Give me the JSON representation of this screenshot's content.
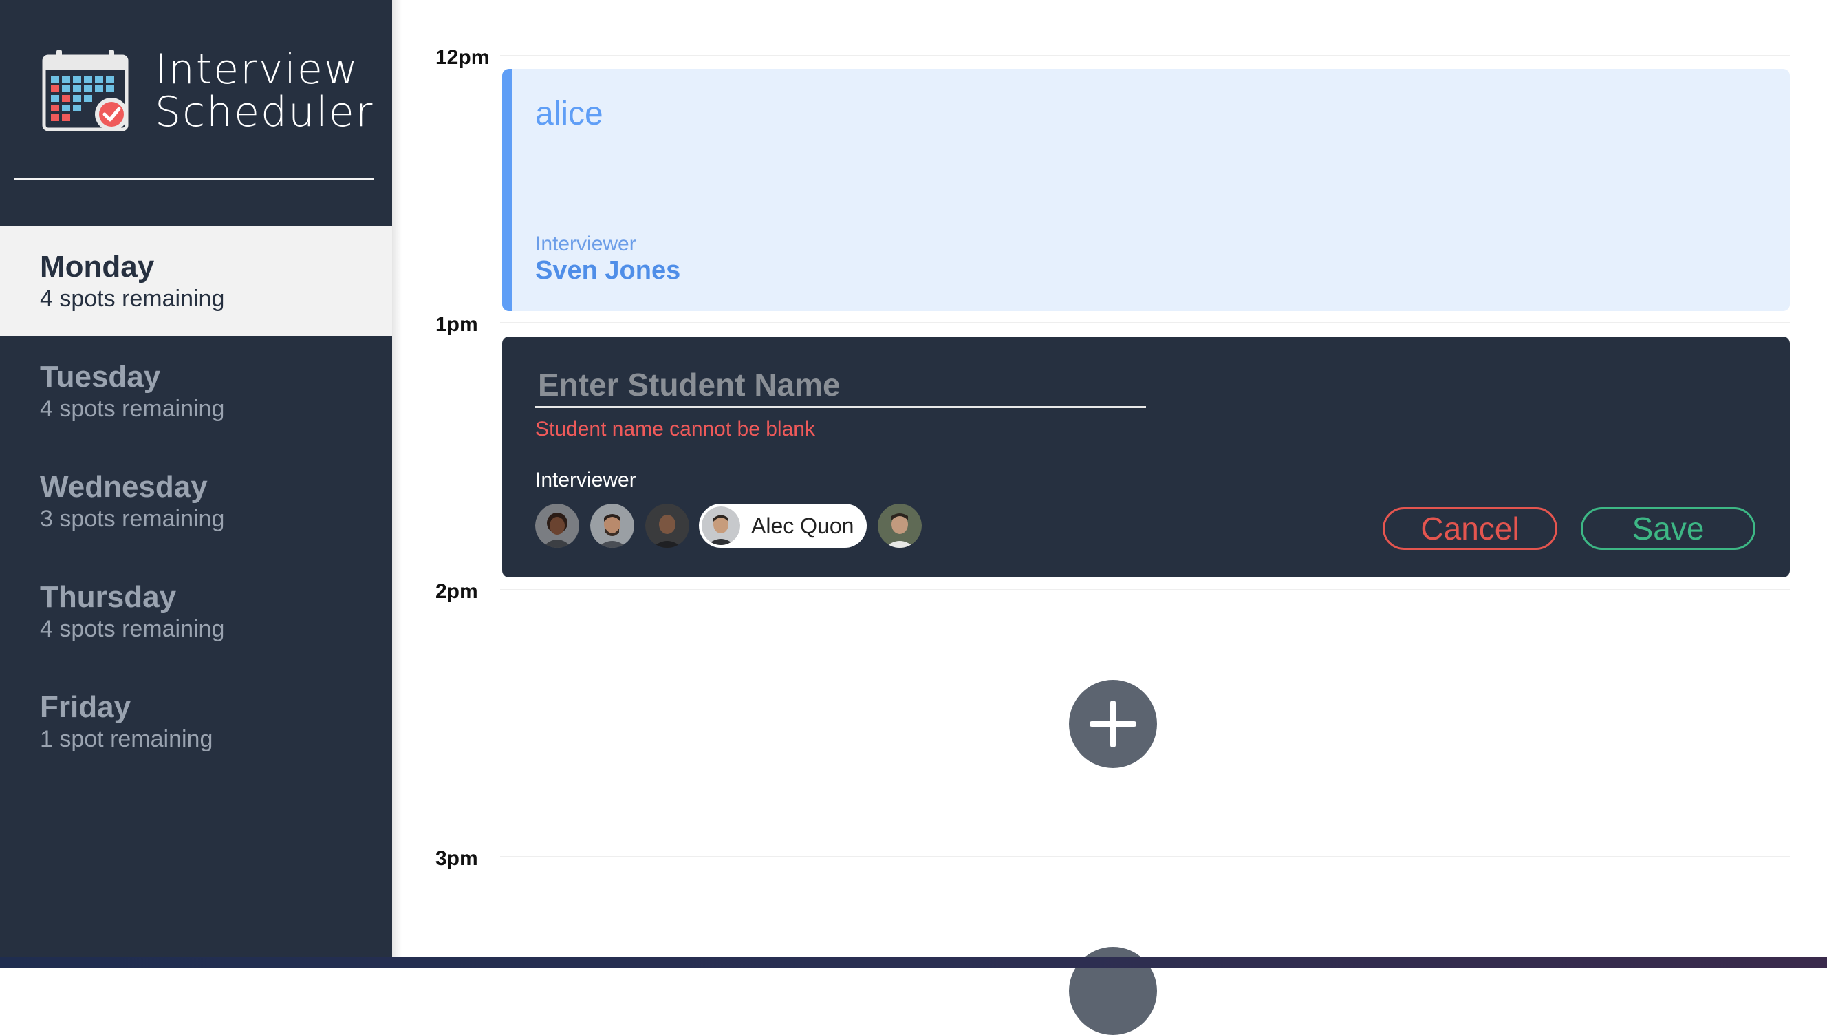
{
  "app": {
    "title_line1": "Interview",
    "title_line2": "Scheduler"
  },
  "sidebar": {
    "days": [
      {
        "name": "Monday",
        "spots": "4 spots remaining",
        "selected": true
      },
      {
        "name": "Tuesday",
        "spots": "4 spots remaining",
        "selected": false
      },
      {
        "name": "Wednesday",
        "spots": "3 spots remaining",
        "selected": false
      },
      {
        "name": "Thursday",
        "spots": "4 spots remaining",
        "selected": false
      },
      {
        "name": "Friday",
        "spots": "1 spot remaining",
        "selected": false
      }
    ]
  },
  "schedule": {
    "times": [
      "12pm",
      "1pm",
      "2pm",
      "3pm"
    ],
    "booked": {
      "student": "alice",
      "interviewer_label": "Interviewer",
      "interviewer_name": "Sven Jones"
    },
    "form": {
      "placeholder": "Enter Student Name",
      "error": "Student name cannot be blank",
      "interviewer_label": "Interviewer",
      "selected_interviewer": "Alec Quon",
      "cancel_label": "Cancel",
      "save_label": "Save"
    }
  },
  "colors": {
    "sidebar_bg": "#263040",
    "booked_bg": "#e6f0fd",
    "booked_accent": "#5f9ef6",
    "error": "#ef5a5a",
    "cancel": "#e4554f",
    "save": "#3db785"
  },
  "icons": {
    "logo": "calendar-check-icon",
    "add": "plus-icon"
  }
}
